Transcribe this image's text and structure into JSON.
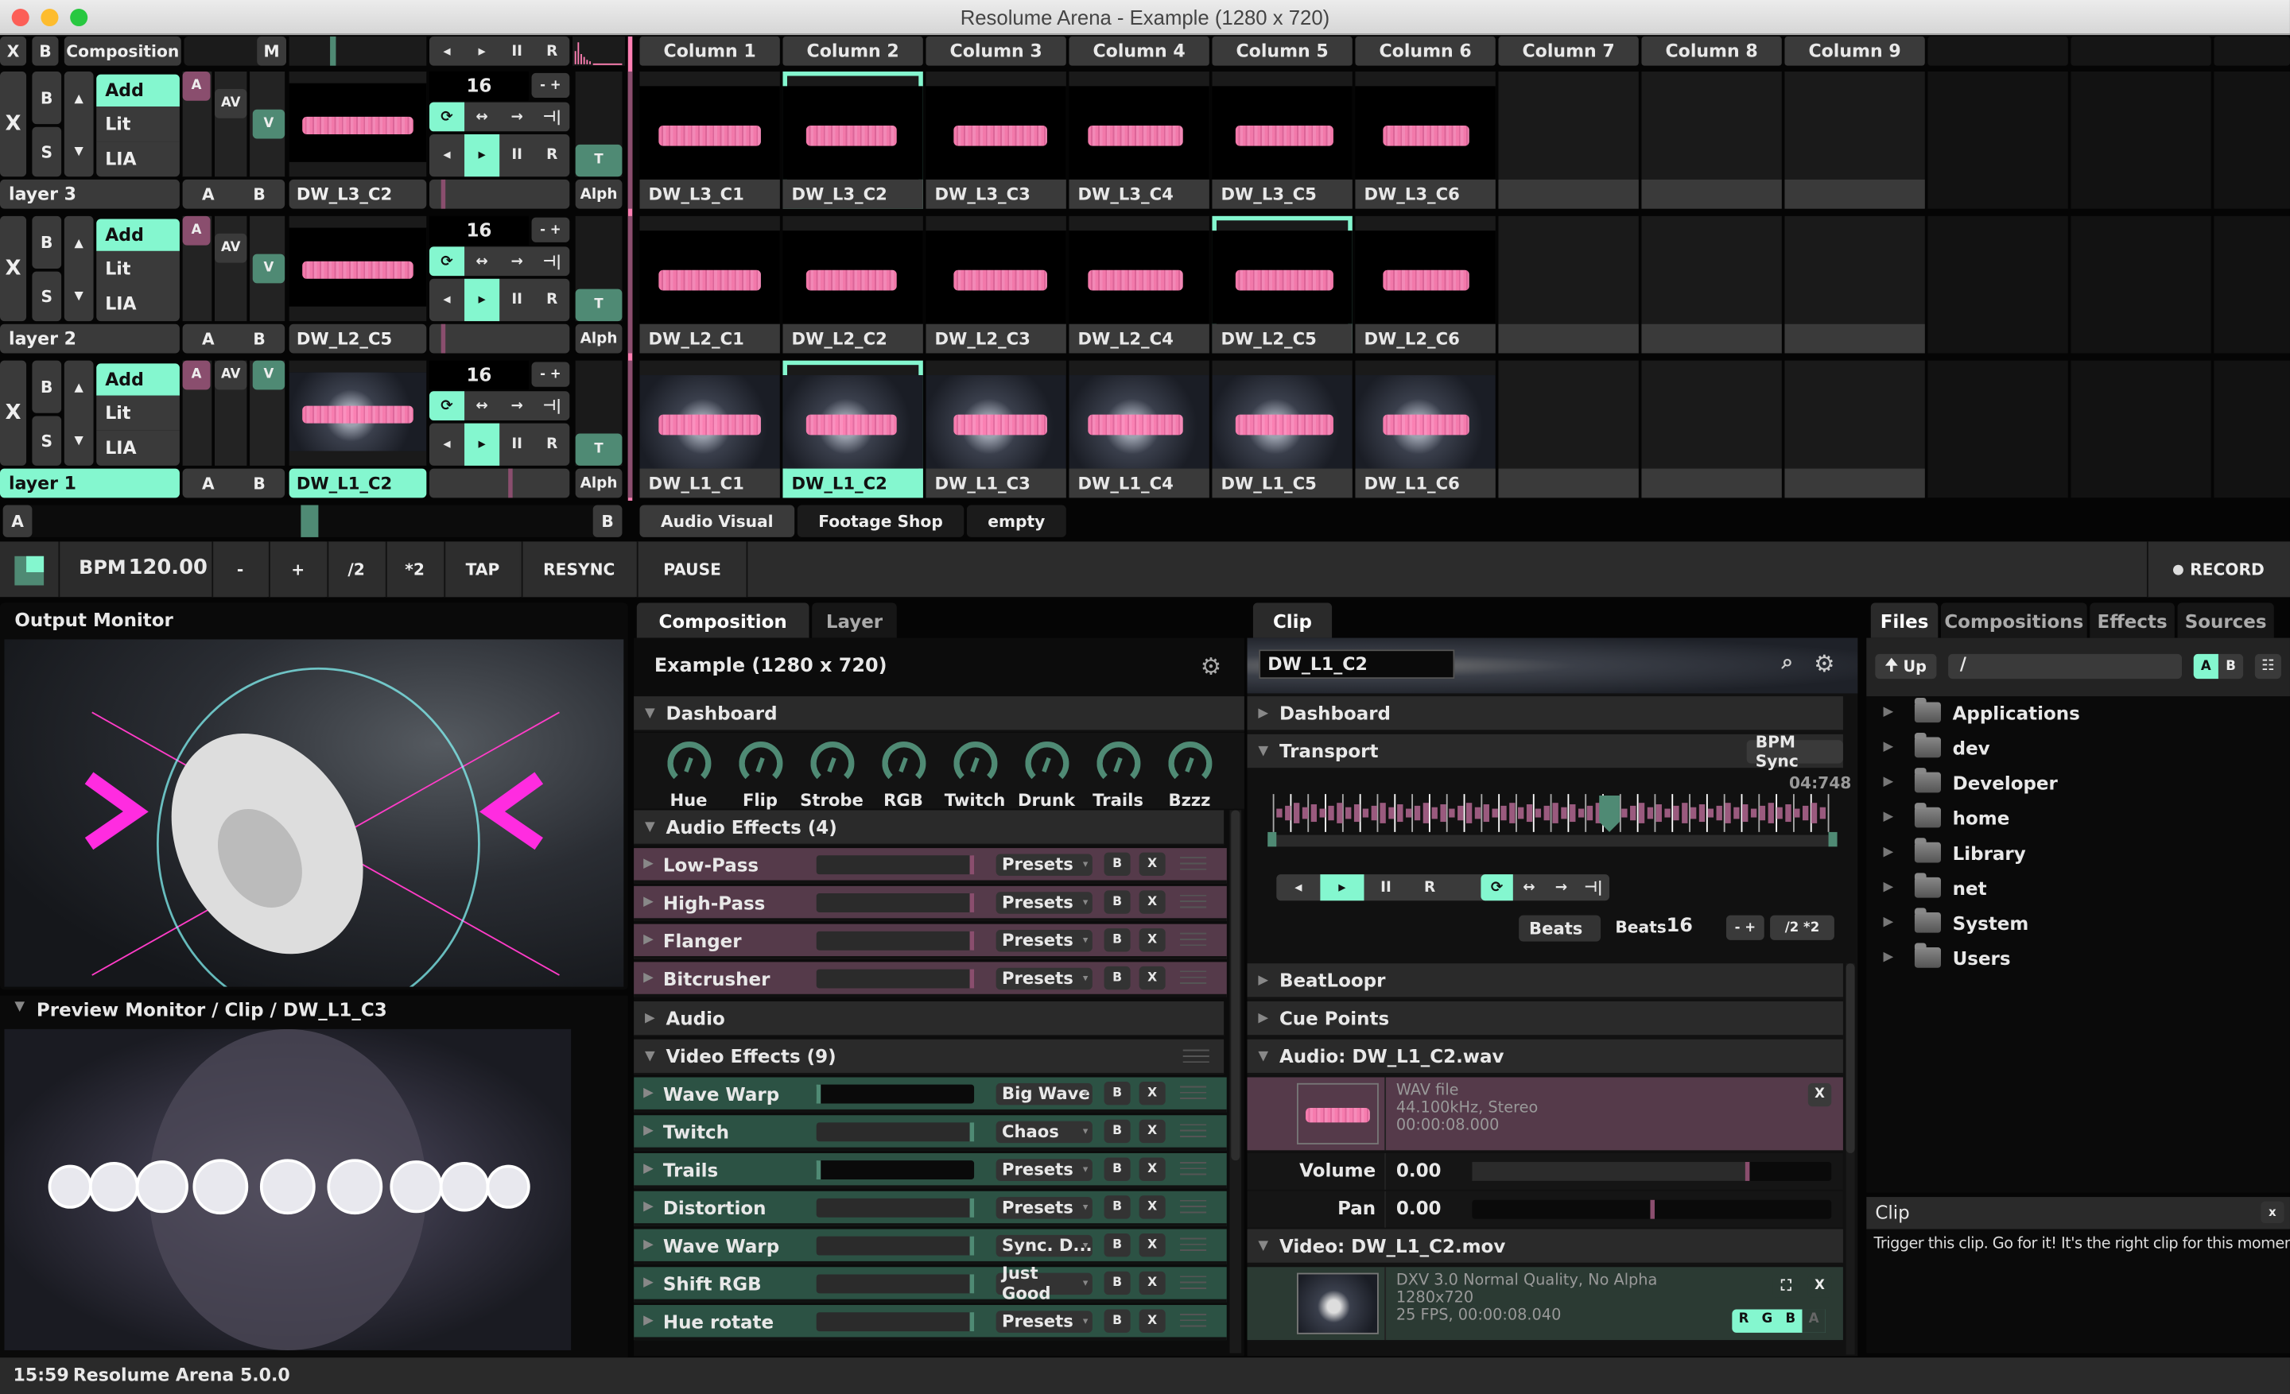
{
  "window": {
    "title": "Resolume Arena - Example (1280 x 720)"
  },
  "colors": {
    "accent_mint": "#84f7cf",
    "teal": "#4f8a74",
    "plum": "#8a4e6e",
    "audio_fx_bg": "#553a4a",
    "video_fx_bg": "#2c5244",
    "waveform_pink": "#ff7fb3"
  },
  "composition_bar": {
    "x": "X",
    "b": "B",
    "label": "Composition",
    "m": "M",
    "prev": "◂",
    "play": "▸",
    "pause": "II",
    "restart": "R"
  },
  "columns": [
    "Column 1",
    "Column 2",
    "Column 3",
    "Column 4",
    "Column 5",
    "Column 6",
    "Column 7",
    "Column 8",
    "Column 9"
  ],
  "layers": [
    {
      "name": "layer 3",
      "active_clip": "DW_L3_C2",
      "selected": false,
      "blend": "Add",
      "lit": "Lit",
      "lia": "LIA",
      "a": "A",
      "av": "AV",
      "v": "V",
      "beats": "16",
      "alph": "Alph",
      "t": "T",
      "ab_a": "A",
      "ab_b": "B",
      "x": "X",
      "b": "B",
      "s": "S",
      "clips": [
        "DW_L3_C1",
        "DW_L3_C2",
        "DW_L3_C3",
        "DW_L3_C4",
        "DW_L3_C5",
        "DW_L3_C6"
      ],
      "selected_clip_index": 1
    },
    {
      "name": "layer 2",
      "active_clip": "DW_L2_C5",
      "selected": false,
      "blend": "Add",
      "lit": "Lit",
      "lia": "LIA",
      "a": "A",
      "av": "AV",
      "v": "V",
      "beats": "16",
      "alph": "Alph",
      "t": "T",
      "ab_a": "A",
      "ab_b": "B",
      "x": "X",
      "b": "B",
      "s": "S",
      "clips": [
        "DW_L2_C1",
        "DW_L2_C2",
        "DW_L2_C3",
        "DW_L2_C4",
        "DW_L2_C5",
        "DW_L2_C6"
      ],
      "selected_clip_index": 4
    },
    {
      "name": "layer 1",
      "active_clip": "DW_L1_C2",
      "selected": true,
      "blend": "Add",
      "lit": "Lit",
      "lia": "LIA",
      "a": "A",
      "av": "AV",
      "v": "V",
      "beats": "16",
      "alph": "Alph",
      "t": "T",
      "ab_a": "A",
      "ab_b": "B",
      "x": "X",
      "b": "B",
      "s": "S",
      "clips": [
        "DW_L1_C1",
        "DW_L1_C2",
        "DW_L1_C3",
        "DW_L1_C4",
        "DW_L1_C5",
        "DW_L1_C6"
      ],
      "selected_clip_index": 1
    }
  ],
  "transport_controls": {
    "minus_plus": "- +",
    "loop": "⟳",
    "bounce": "↔",
    "forward": "→",
    "random": "⊣|",
    "prev": "◂",
    "play": "▸",
    "pause": "II",
    "restart": "R"
  },
  "crossfader": {
    "a": "A",
    "b": "B",
    "position": 0.5
  },
  "decks": [
    "Audio Visual",
    "Footage Shop",
    "empty"
  ],
  "bpm_bar": {
    "bpm_label": "BPM",
    "bpm_value": "120.00",
    "minus": "-",
    "plus": "+",
    "half": "/2",
    "double": "*2",
    "tap": "TAP",
    "resync": "RESYNC",
    "pause": "PAUSE",
    "record": "RECORD"
  },
  "output_monitor": {
    "title": "Output Monitor"
  },
  "preview_monitor": {
    "title": "Preview Monitor / Clip / DW_L1_C3"
  },
  "status_bar": {
    "time": "15:59",
    "version": "Resolume Arena 5.0.0"
  },
  "composition_panel": {
    "tabs": [
      "Composition",
      "Layer"
    ],
    "active_tab": "Composition",
    "title": "Example (1280 x 720)",
    "dashboard_label": "Dashboard",
    "knobs": [
      "Hue",
      "Flip",
      "Strobe",
      "RGB",
      "Twitch",
      "Drunk",
      "Trails",
      "Bzzz"
    ],
    "audio_effects_label": "Audio Effects (4)",
    "audio_effects": [
      {
        "name": "Low-Pass",
        "preset": "Presets",
        "value": 1.0
      },
      {
        "name": "High-Pass",
        "preset": "Presets",
        "value": 1.0
      },
      {
        "name": "Flanger",
        "preset": "Presets",
        "value": 1.0
      },
      {
        "name": "Bitcrusher",
        "preset": "Presets",
        "value": 1.0
      }
    ],
    "audio_label": "Audio",
    "video_effects_label": "Video Effects (9)",
    "video_effects": [
      {
        "name": "Wave Warp",
        "preset": "Big Wave",
        "value": 0.0
      },
      {
        "name": "Twitch",
        "preset": "Chaos",
        "value": 1.0
      },
      {
        "name": "Trails",
        "preset": "Presets",
        "value": 0.0
      },
      {
        "name": "Distortion",
        "preset": "Presets",
        "value": 1.0
      },
      {
        "name": "Wave Warp",
        "preset": "Sync. D...",
        "value": 1.0
      },
      {
        "name": "Shift RGB",
        "preset": "Just Good",
        "value": 1.0
      },
      {
        "name": "Hue rotate",
        "preset": "Presets",
        "value": 1.0
      }
    ],
    "b_label": "B",
    "x_label": "X"
  },
  "clip_panel": {
    "tab": "Clip",
    "clip_name": "DW_L1_C2",
    "dashboard_label": "Dashboard",
    "transport_label": "Transport",
    "sync_mode": "BPM Sync",
    "time": "04:748",
    "playhead_position": 0.6,
    "beats_mode": "Beats",
    "beats_label": "Beats",
    "beats_value": "16",
    "minus_plus": "- +",
    "half_double": "/2 *2",
    "beatloopr_label": "BeatLoopr",
    "cue_points_label": "Cue Points",
    "audio_label": "Audio: DW_L1_C2.wav",
    "audio_info": [
      "WAV file",
      "44.100kHz, Stereo",
      "00:00:08.000"
    ],
    "volume_label": "Volume",
    "volume_value": "0.00",
    "volume_position": 0.76,
    "pan_label": "Pan",
    "pan_value": "0.00",
    "pan_position": 0.5,
    "video_label": "Video: DW_L1_C2.mov",
    "video_info": [
      "DXV 3.0 Normal Quality, No Alpha",
      "1280x720",
      "25 FPS, 00:00:08.040"
    ],
    "channels": [
      "R",
      "G",
      "B",
      "A"
    ],
    "x_label": "X"
  },
  "browser": {
    "tabs": [
      "Files",
      "Compositions",
      "Effects",
      "Sources"
    ],
    "active_tab": "Files",
    "up_label": "Up",
    "path": "/",
    "ab": [
      "A",
      "B"
    ],
    "folders": [
      "Applications",
      "dev",
      "Developer",
      "home",
      "Library",
      "net",
      "System",
      "Users"
    ]
  },
  "help_panel": {
    "title": "Clip",
    "text": "Trigger this clip. Go for it! It's the right clip for this moment.",
    "close": "x"
  }
}
